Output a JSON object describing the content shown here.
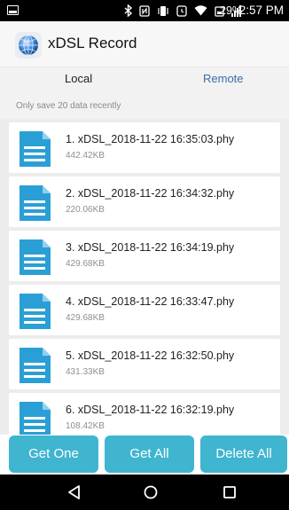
{
  "status_bar": {
    "battery": "29%",
    "time": "2:57 PM",
    "icons": [
      "image-icon",
      "bluetooth-icon",
      "nfc-icon",
      "vibrate-icon",
      "alarm-icon",
      "wifi-icon",
      "battery-saver-icon",
      "signal-icon"
    ]
  },
  "app_bar": {
    "title": "xDSL Record",
    "logo": "globe-logo-icon"
  },
  "tabs": {
    "local": "Local",
    "remote": "Remote"
  },
  "hint": "Only save 20 data recently",
  "files": [
    {
      "name": "1. xDSL_2018-11-22 16:35:03.phy",
      "size": "442.42KB"
    },
    {
      "name": "2. xDSL_2018-11-22 16:34:32.phy",
      "size": "220.06KB"
    },
    {
      "name": "3. xDSL_2018-11-22 16:34:19.phy",
      "size": "429.68KB"
    },
    {
      "name": "4. xDSL_2018-11-22 16:33:47.phy",
      "size": "429.68KB"
    },
    {
      "name": "5. xDSL_2018-11-22 16:32:50.phy",
      "size": "431.33KB"
    },
    {
      "name": "6. xDSL_2018-11-22 16:32:19.phy",
      "size": "108.42KB"
    }
  ],
  "buttons": {
    "get_one": "Get One",
    "get_all": "Get All",
    "delete_all": "Delete All"
  },
  "nav": {
    "back": "back-icon",
    "home": "home-icon",
    "recents": "recents-icon"
  },
  "colors": {
    "accent": "#3fb5d0",
    "remote_tab": "#3a6ea8",
    "file_icon": "#2a9fd6",
    "status_bar": "#000000"
  }
}
